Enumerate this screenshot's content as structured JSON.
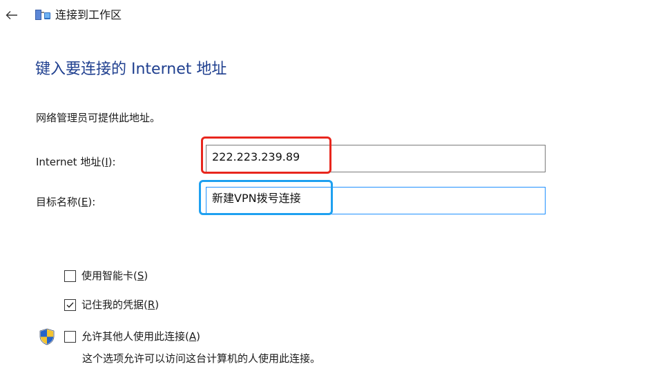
{
  "window": {
    "title": "连接到工作区",
    "back_icon": "arrow-left-icon",
    "app_icon": "workplace-network-icon"
  },
  "page": {
    "heading": "键入要连接的 Internet 地址",
    "info": "网络管理员可提供此地址。"
  },
  "fields": {
    "internet_address": {
      "label": "Internet 地址(",
      "accesskey": "I",
      "label_end": "):",
      "value": "222.223.239.89"
    },
    "destination_name": {
      "label": "目标名称(",
      "accesskey": "E",
      "label_end": "):",
      "value": "新建VPN拨号连接"
    }
  },
  "highlights": {
    "address_color": "#e8261d",
    "destination_color": "#1ea0f0"
  },
  "options": {
    "smart_card": {
      "label": "使用智能卡(",
      "accesskey": "S",
      "label_end": ")",
      "checked": false
    },
    "remember": {
      "label": "记住我的凭据(",
      "accesskey": "R",
      "label_end": ")",
      "checked": true
    },
    "allow_others": {
      "label": "允许其他人使用此连接(",
      "accesskey": "A",
      "label_end": ")",
      "checked": false,
      "icon": "uac-shield-icon",
      "description": "这个选项允许可以访问这台计算机的人使用此连接。"
    }
  },
  "colors": {
    "heading": "#1f3f8f",
    "focus_border": "#1e90ff"
  }
}
